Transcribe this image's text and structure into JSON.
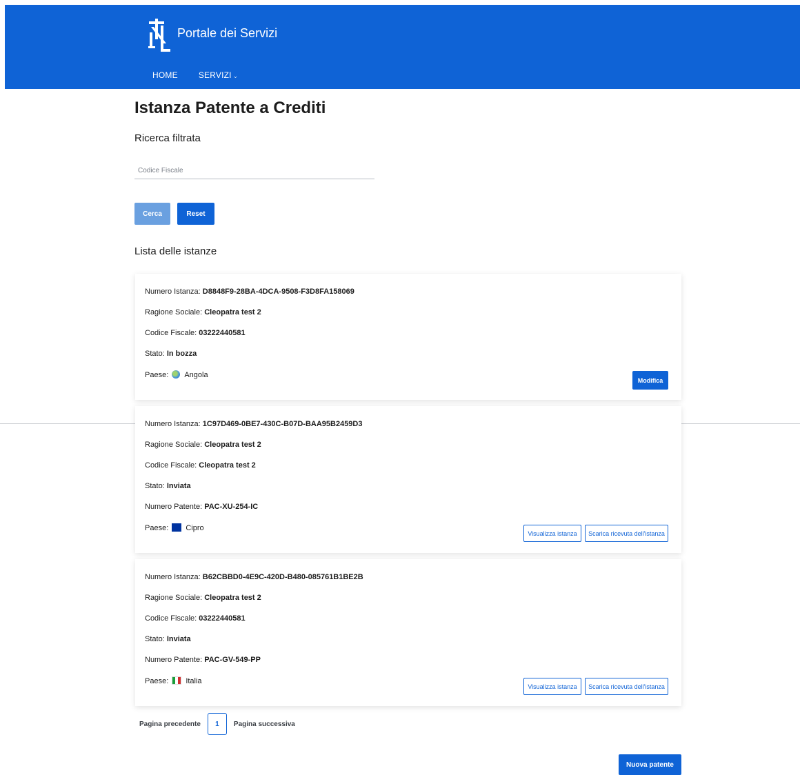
{
  "header": {
    "title": "Portale dei Servizi",
    "nav": [
      {
        "label": "HOME"
      },
      {
        "label": "SERVIZI"
      }
    ]
  },
  "page": {
    "title": "Istanza Patente a Crediti",
    "filter_title": "Ricerca filtrata",
    "search": {
      "placeholder": "Codice Fiscale",
      "value": ""
    },
    "cerca_label": "Cerca",
    "reset_label": "Reset",
    "list_title": "Lista delle istanze"
  },
  "labels": {
    "numero_istanza": "Numero Istanza:",
    "ragione_sociale": "Ragione Sociale:",
    "codice_fiscale": "Codice Fiscale:",
    "stato": "Stato:",
    "numero_patente": "Numero Patente:",
    "paese": "Paese:"
  },
  "instances": [
    {
      "numero_istanza": "D8848F9-28BA-4DCA-9508-F3D8FA158069",
      "ragione_sociale": "Cleopatra test 2",
      "codice_fiscale": "03222440581",
      "stato": "In bozza",
      "paese": "Angola",
      "flag_icon": "globe-icon",
      "actions": [
        "Modifica"
      ]
    },
    {
      "numero_istanza": "1C97D469-0BE7-430C-B07D-BAA95B2459D3",
      "ragione_sociale": "Cleopatra test 2",
      "codice_fiscale": "Cleopatra test 2",
      "stato": "Inviata",
      "numero_patente": "PAC-XU-254-IC",
      "paese": "Cipro",
      "flag_icon": "eu-flag-icon",
      "actions": [
        "Visualizza istanza",
        "Scarica ricevuta dell'istanza"
      ]
    },
    {
      "numero_istanza": "B62CBBD0-4E9C-420D-B480-085761B1BE2B",
      "ragione_sociale": "Cleopatra test 2",
      "codice_fiscale": "03222440581",
      "stato": "Inviata",
      "numero_patente": "PAC-GV-549-PP",
      "paese": "Italia",
      "flag_icon": "italy-flag-icon",
      "actions": [
        "Visualizza istanza",
        "Scarica ricevuta dell'istanza"
      ]
    }
  ],
  "pagination": {
    "prev_label": "Pagina precedente",
    "current_page": "1",
    "next_label": "Pagina successiva"
  },
  "nuova_patente_label": "Nuova patente",
  "colors": {
    "primary": "#0f63d6",
    "primary_light": "#6aa0e0",
    "header_bg": "#0f63d6"
  }
}
